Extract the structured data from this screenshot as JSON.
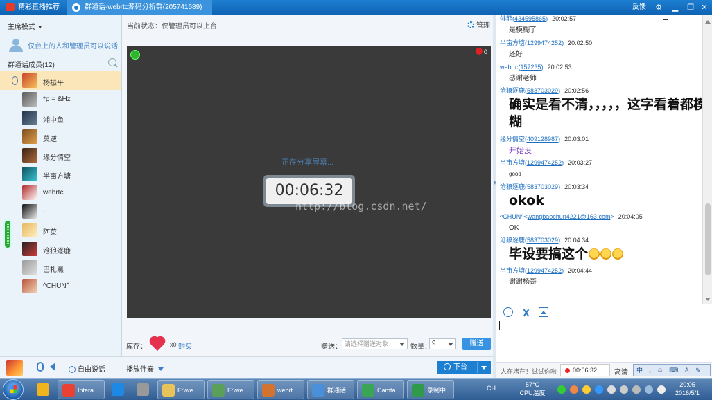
{
  "titlebar": {
    "tab_live": "精彩直播推荐",
    "tab_group": "群通话-webrtc源码分析群(205741689)",
    "feedback": "反馈",
    "skin_icon": "skin-icon",
    "minimize_icon": "minimize-icon",
    "maximize_icon": "maximize-icon",
    "close_icon": "close-icon"
  },
  "left": {
    "mode_label": "主席模式",
    "notice": "仅台上的人和管理员可以说话",
    "members_title": "群通话成员(12)",
    "members": [
      {
        "name": "杨振平",
        "color1": "#c8452f",
        "color2": "#f6c35a",
        "selected": true
      },
      {
        "name": "*p = &Hz",
        "color1": "#5b5b5b",
        "color2": "#bdbdbd"
      },
      {
        "name": "湘中鱼",
        "color1": "#22334a",
        "color2": "#6a7f95"
      },
      {
        "name": "莫逆",
        "color1": "#7a4f22",
        "color2": "#e4a04a"
      },
      {
        "name": "缘分情空",
        "color1": "#3a2416",
        "color2": "#b06b3e"
      },
      {
        "name": "半亩方塘",
        "color1": "#0e4f5e",
        "color2": "#3cc6d6"
      },
      {
        "name": "webrtc",
        "color1": "#b22a2a",
        "color2": "#ffffff"
      },
      {
        "name": "·",
        "color1": "#111111",
        "color2": "#eeeeee"
      },
      {
        "name": "阿菜",
        "color1": "#e6b65c",
        "color2": "#fff1c2"
      },
      {
        "name": "沧狼逐鹿",
        "color1": "#222222",
        "color2": "#d33b3b"
      },
      {
        "name": "巴扎黑",
        "color1": "#9a9a9a",
        "color2": "#e0e0e0"
      },
      {
        "name": "^CHUN^",
        "color1": "#b8553a",
        "color2": "#f3d6b8"
      }
    ]
  },
  "center": {
    "status": "当前状态：仅管理员可以上台",
    "manage": "管理",
    "rec_count": "0",
    "sharing_text": "正在分享屏幕...",
    "timer": "00:06:32",
    "watermark": "http://blog.csdn.net/",
    "stock_label": "库存：",
    "gift_count": "x0",
    "buy": "购买",
    "give_label": "赠送：",
    "give_placeholder": "请选择赠送对象",
    "qty_label": "数量：",
    "qty_value": "9",
    "give_button": "赠送"
  },
  "footer": {
    "free_talk": "自由说话",
    "music": "播放伴奏",
    "down_button": "下台"
  },
  "chat": {
    "messages": [
      {
        "sender": "俳菲",
        "qq": "434595865",
        "time": "20:02:57",
        "text": "是模糊了",
        "style": "small"
      },
      {
        "sender": "半亩方塘",
        "qq": "1299474252",
        "time": "20:02:50",
        "text": "还好",
        "style": "small"
      },
      {
        "sender": "webrtc",
        "qq": "157235",
        "time": "20:02:53",
        "text": "感谢老师",
        "style": "small"
      },
      {
        "sender": "沧狼逐鹿",
        "qq": "583703029",
        "time": "20:02:56",
        "text": "确实是看不清，，，，，这字看着都模糊",
        "style": "big"
      },
      {
        "sender": "缘分情空",
        "qq": "409128987",
        "time": "20:03:01",
        "text": "开始没",
        "style": "purple"
      },
      {
        "sender": "半亩方塘",
        "qq": "1299474252",
        "time": "20:03:27",
        "text": "good",
        "style": "tiny"
      },
      {
        "sender": "沧狼逐鹿",
        "qq": "583703029",
        "time": "20:03:34",
        "text": "okok",
        "style": "big"
      },
      {
        "sender": "^CHUN^",
        "qq": "wangbaochun4221@163.com",
        "time": "20:04:05",
        "text": "OK",
        "style": "small",
        "angle": true
      },
      {
        "sender": "沧狼逐鹿",
        "qq": "583703029",
        "time": "20:04:34",
        "text": "毕设要搞这个",
        "style": "big",
        "emojis": 3
      },
      {
        "sender": "半亩方塘",
        "qq": "1299474252",
        "time": "20:04:44",
        "text": "谢谢杨哥",
        "style": "small"
      }
    ],
    "note": "人在堵在！试试你啦",
    "rec_time": "00:06:32",
    "quality": "高清",
    "ime_text": "中 ，☺ ⌨ ♙ ✎"
  },
  "taskbar": {
    "items": [
      {
        "label": "",
        "color": "#f0b51e",
        "width": 34
      },
      {
        "label": "Intera...",
        "color": "#e94235",
        "width": 70
      },
      {
        "label": "",
        "color": "#1e88e5",
        "width": 34
      },
      {
        "label": "",
        "color": "#999999",
        "width": 34
      },
      {
        "label": "E:\\we...",
        "color": "#e8c35a",
        "width": 70
      },
      {
        "label": "E:\\we...",
        "color": "#5aa05a",
        "width": 70
      },
      {
        "label": "webrt...",
        "color": "#d2742f",
        "width": 70
      },
      {
        "label": "群通话...",
        "color": "#4a90d9",
        "width": 70
      },
      {
        "label": "Camta...",
        "color": "#3aa655",
        "width": 70
      },
      {
        "label": "录制中...",
        "color": "#2f9a4a",
        "width": 70
      }
    ],
    "lang": "CH",
    "cpu_temp": "57°C",
    "cpu_label": "CPU温度",
    "time": "20:05",
    "date": "2016/5/1"
  }
}
